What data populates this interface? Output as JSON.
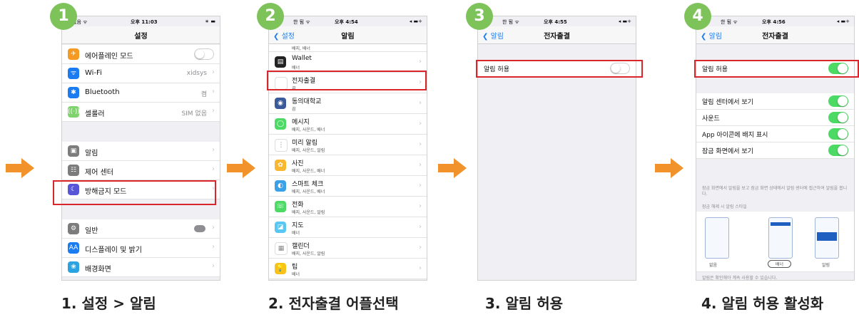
{
  "steps": [
    {
      "number": "1",
      "caption": "1. 설정 > 알림",
      "status": {
        "carrier": "없음 ᯤ",
        "time": "오후 11:03",
        "battery": "∗ ▬"
      },
      "title": "설정",
      "rows": [
        {
          "label": "에어플레인 모드",
          "icon": "✈",
          "color": "#f59a23"
        },
        {
          "label": "Wi-Fi",
          "value": "xidsys",
          "icon": "ᯤ",
          "color": "#1a7cf0"
        },
        {
          "label": "Bluetooth",
          "value": "켬",
          "icon": "✱",
          "color": "#1a7cf0"
        },
        {
          "label": "셀룰러",
          "value": "SIM 없음",
          "icon": "((·))",
          "color": "#7ed36c"
        },
        {
          "label": "알림",
          "icon": "▣",
          "color": "#7c7c7c"
        },
        {
          "label": "제어 센터",
          "icon": "☷",
          "color": "#7c7c7c"
        },
        {
          "label": "방해금지 모드",
          "icon": "☾",
          "color": "#5856d6"
        },
        {
          "label": "일반",
          "icon": "⚙",
          "color": "#7c7c7c"
        },
        {
          "label": "디스플레이 및 밝기",
          "icon": "AA",
          "color": "#1a7cf0"
        },
        {
          "label": "배경화면",
          "icon": "❀",
          "color": "#2aa3e0"
        }
      ]
    },
    {
      "number": "2",
      "caption": "2. 전자출결 어플선택",
      "status": {
        "carrier": "한 됨 ᯤ",
        "time": "오후 4:54",
        "battery": "◂ ▬+"
      },
      "title": "알림",
      "back": "설정",
      "partial": "배지, 배너",
      "rows": [
        {
          "label": "Wallet",
          "sub": "배너",
          "icon": "▤",
          "color": "#222"
        },
        {
          "label": "전자출결",
          "sub": "끔",
          "icon": "",
          "color": "#ffffff"
        },
        {
          "label": "동의대학교",
          "sub": "끔",
          "icon": "◉",
          "color": "#3b5a9a"
        },
        {
          "label": "메시지",
          "sub": "배지, 사운드, 배너",
          "icon": "◯",
          "color": "#4cd964"
        },
        {
          "label": "미리 알림",
          "sub": "배지, 사운드, 알림",
          "icon": "⋮",
          "color": "#ffffff"
        },
        {
          "label": "사진",
          "sub": "배지, 사운드, 배너",
          "icon": "✿",
          "color": "#f7b731"
        },
        {
          "label": "스마트 체크",
          "sub": "배지, 사운드, 배너",
          "icon": "◐",
          "color": "#3aa0e8"
        },
        {
          "label": "전화",
          "sub": "배지, 사운드, 알림",
          "icon": "☏",
          "color": "#4cd964"
        },
        {
          "label": "지도",
          "sub": "배너",
          "icon": "◪",
          "color": "#59c7f4"
        },
        {
          "label": "캘린더",
          "sub": "배지, 사운드, 알림",
          "icon": "▦",
          "color": "#ffffff"
        },
        {
          "label": "팁",
          "sub": "배너",
          "icon": "💡",
          "color": "#f7c31b"
        }
      ]
    },
    {
      "number": "3",
      "caption": "3. 알림 허용",
      "status": {
        "carrier": "한 됨 ᯤ",
        "time": "오후 4:55",
        "battery": "◂ ▬+"
      },
      "title": "전자출결",
      "back": "알림",
      "allow_label": "알림 허용"
    },
    {
      "number": "4",
      "caption": "4. 알림 허용 활성화",
      "status": {
        "carrier": "한 됨 ᯤ",
        "time": "오후 4:56",
        "battery": "◂ ▬+"
      },
      "title": "전자출결",
      "back": "알림",
      "allow_label": "알림 허용",
      "toggles": [
        "알림 센터에서 보기",
        "사운드",
        "App 아이콘에 배지 표시",
        "잠금 화면에서 보기"
      ],
      "lock_note": "잠금 화면에서 알림을 보고 잠금 화면 상태에서 알림 센터에 접근하여 알림을 봅니다.",
      "style_header": "잠금 해제 시 알림 스타일",
      "styles": [
        "없음",
        "배너",
        "알림"
      ],
      "bottom_note": "알림은 확인해야 계속 사용할 수 있습니다."
    }
  ],
  "colors": {
    "accent": "#d8262c",
    "badge": "#7dc35a",
    "arrow": "#f2922a",
    "ios_blue": "#1a7cf0",
    "switch_on": "#4cd964"
  }
}
